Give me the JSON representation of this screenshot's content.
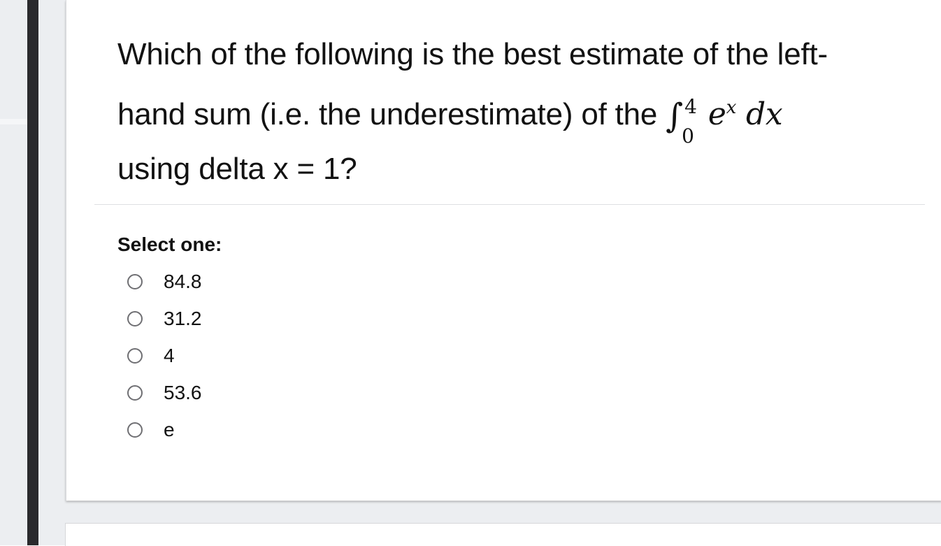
{
  "question": {
    "text": "Which of the following is the best estimate of the left-hand sum (i.e. the underestimate) of the",
    "integral": {
      "symbol": "∫",
      "lower_limit": "0",
      "upper_limit": "4",
      "base": "e",
      "exponent": "x",
      "differential": "dx"
    },
    "text_after": "using delta x = 1?"
  },
  "answer_prompt": "Select one:",
  "options": [
    {
      "label": "84.8",
      "selected": false
    },
    {
      "label": "31.2",
      "selected": false
    },
    {
      "label": "4",
      "selected": false
    },
    {
      "label": "53.6",
      "selected": false
    },
    {
      "label": "e",
      "selected": false
    }
  ],
  "colors": {
    "text": "#121212",
    "background_pane": "#eceef1",
    "dark_rail": "#2a2a2d",
    "radio_border": "#6f6f73"
  }
}
